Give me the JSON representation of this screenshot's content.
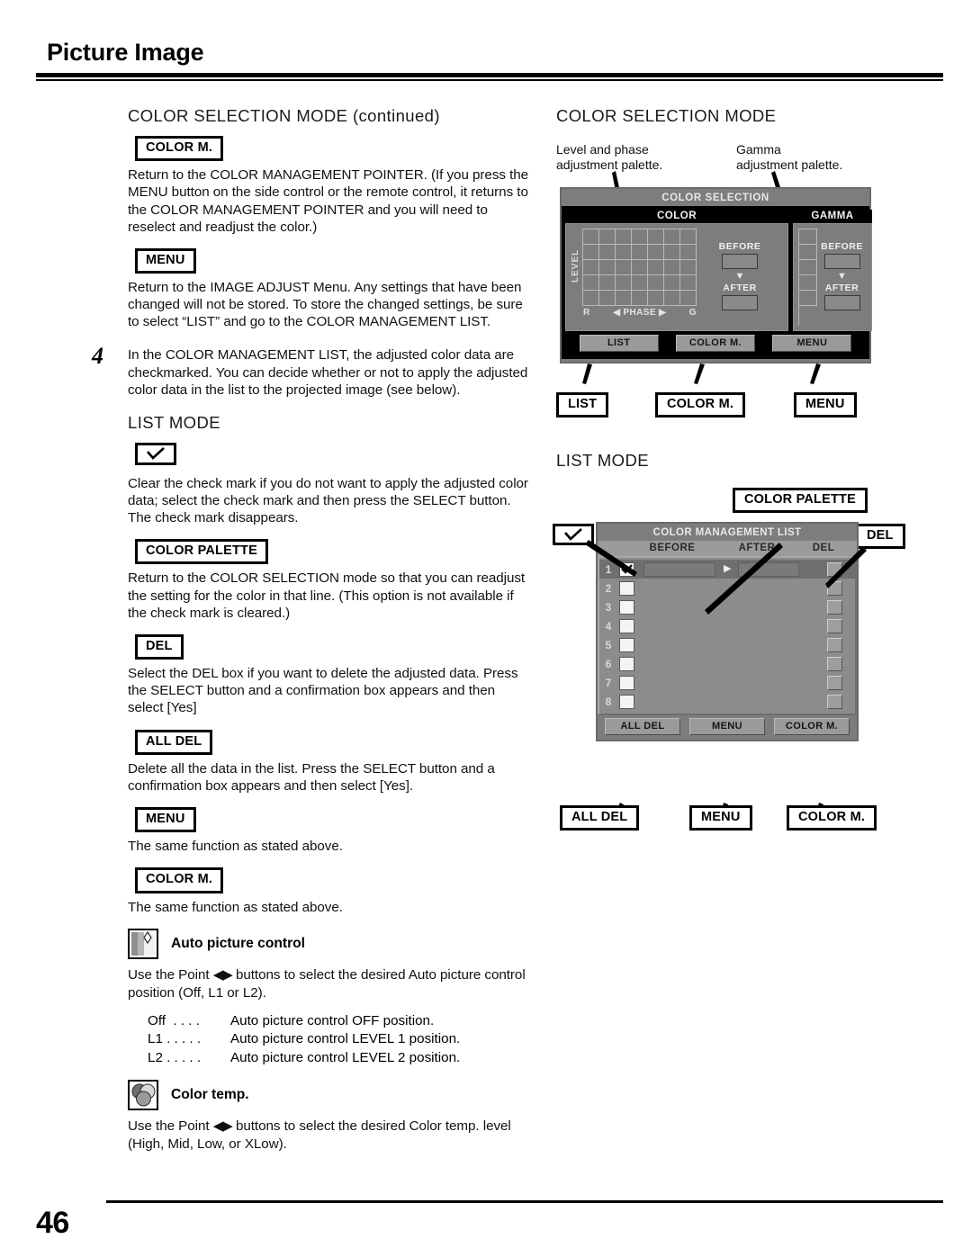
{
  "header": {
    "title": "Picture Image"
  },
  "footer": {
    "page_number": "46"
  },
  "left_column": {
    "section_title": "COLOR SELECTION MODE (continued)",
    "entries": [
      {
        "key": "COLOR M.",
        "text": "Return to the COLOR MANAGEMENT POINTER. (If you press the MENU button on the side control or the remote control, it returns to the COLOR MANAGEMENT POINTER and you will need to reselect and readjust the color.)"
      },
      {
        "key": "MENU",
        "text": "Return to the IMAGE ADJUST Menu. Any settings that have been changed will not be stored. To store the changed settings, be sure to select “LIST” and go to the COLOR MANAGEMENT LIST."
      }
    ],
    "step": {
      "number": "4",
      "text": "In the COLOR MANAGEMENT LIST, the adjusted color data are checkmarked. You can decide whether or not to apply the adjusted color data in the list to the projected image (see below)."
    },
    "list_mode_title": "LIST MODE",
    "list_mode_entries": [
      {
        "key": "check-mark-icon",
        "is_icon": true,
        "text": "Clear the check mark if you do not want to apply the adjusted color data; select the check mark and then press the SELECT button. The check mark disappears."
      },
      {
        "key": "COLOR PALETTE",
        "text": "Return to the COLOR SELECTION mode so that you can readjust the setting for the color in that line. (This option is not available if the check mark is cleared.)"
      },
      {
        "key": "DEL",
        "text": "Select the DEL box if you want to delete the adjusted data. Press the SELECT button and a confirmation box appears and then select [Yes]"
      },
      {
        "key": "ALL DEL",
        "text": "Delete all the data in the list. Press the SELECT button and a confirmation box appears and then select [Yes]."
      },
      {
        "key": "MENU",
        "text": "The same function as stated above."
      },
      {
        "key": "COLOR M.",
        "text": "The same function as stated above."
      }
    ],
    "auto_picture_control": {
      "icon": "auto-picture-control-icon",
      "heading": "Auto picture control",
      "text": "Use the Point ◀▶ buttons to select the desired Auto picture control position (Off, L1 or L2).",
      "text_before_arrows": "Use the Point",
      "arrows": "◀▶",
      "text_after_arrows": "buttons to select the desired Auto picture control position (Off, L1 or L2).",
      "options": [
        {
          "term": "Off  . . . .",
          "desc": "Auto picture control OFF position."
        },
        {
          "term": "L1 . . . . .",
          "desc": "Auto picture control LEVEL 1 position."
        },
        {
          "term": "L2 . . . . .",
          "desc": "Auto picture control LEVEL 2 position."
        }
      ]
    },
    "color_temp": {
      "icon": "color-temp-icon",
      "heading": "Color temp.",
      "text_before_arrows": "Use the Point",
      "arrows": "◀▶",
      "text_after_arrows": "buttons to select the desired Color temp. level (High, Mid, Low, or XLow)."
    }
  },
  "right_column": {
    "color_selection": {
      "section_title": "COLOR SELECTION MODE",
      "annotation_left": "Level and phase\nadjustment palette.",
      "annotation_right": "Gamma\nadjustment palette.",
      "osd": {
        "title": "COLOR SELECTION",
        "color_header": "COLOR",
        "gamma_header": "GAMMA",
        "level_label": "LEVEL",
        "phase_left": "R",
        "phase_label": "PHASE",
        "phase_right": "G",
        "phase_arrow_left": "◀",
        "phase_arrow_right": "▶",
        "before_label": "BEFORE",
        "after_label": "AFTER",
        "transition_arrow": "▼",
        "buttons": [
          "LIST",
          "COLOR M.",
          "MENU"
        ],
        "color_grid_cols": 7,
        "color_grid_rows": 5,
        "gamma_grid_rows": 5
      },
      "callouts": [
        "LIST",
        "COLOR M.",
        "MENU"
      ]
    },
    "list_mode": {
      "section_title": "LIST MODE",
      "callout_check": "check-mark-icon",
      "callout_color_palette": "COLOR PALETTE",
      "callout_del": "DEL",
      "osd": {
        "title": "COLOR MANAGEMENT LIST",
        "columns": [
          "BEFORE",
          "AFTER",
          "DEL"
        ],
        "rows": [
          {
            "index": "1",
            "checked": true
          },
          {
            "index": "2",
            "checked": false
          },
          {
            "index": "3",
            "checked": false
          },
          {
            "index": "4",
            "checked": false
          },
          {
            "index": "5",
            "checked": false
          },
          {
            "index": "6",
            "checked": false
          },
          {
            "index": "7",
            "checked": false
          },
          {
            "index": "8",
            "checked": false
          }
        ],
        "buttons": [
          "ALL DEL",
          "MENU",
          "COLOR M."
        ]
      },
      "bottom_callouts": [
        "ALL DEL",
        "MENU",
        "COLOR M."
      ]
    }
  }
}
